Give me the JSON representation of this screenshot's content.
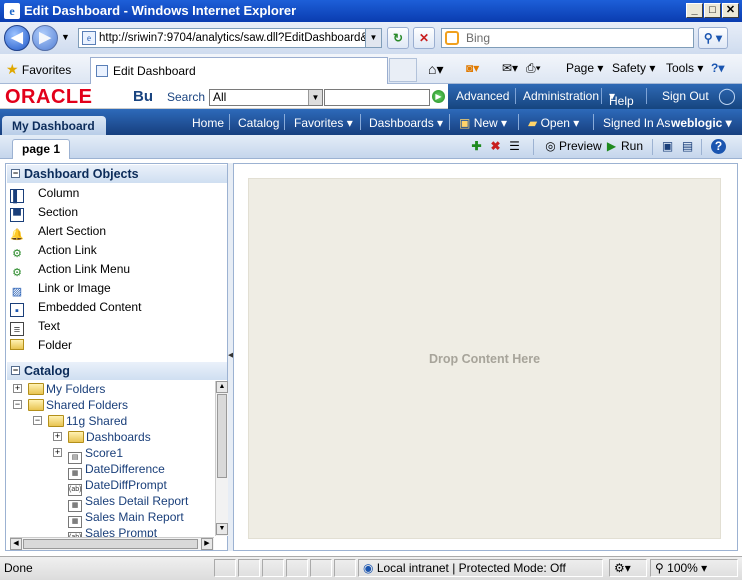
{
  "window": {
    "title": "Edit Dashboard - Windows Internet Explorer"
  },
  "address": {
    "url": "http://sriwin7:9704/analytics/saw.dll?EditDashboard&P",
    "search_placeholder": "Bing"
  },
  "favorites_bar": {
    "favorites_label": "Favorites",
    "tab_title": "Edit Dashboard"
  },
  "commands": {
    "page": "Page",
    "safety": "Safety",
    "tools": "Tools"
  },
  "oracle": {
    "logo": "ORACLE",
    "bu": "Bu",
    "search_label": "Search",
    "search_scope": "All"
  },
  "global_nav": {
    "advanced": "Advanced",
    "administration": "Administration",
    "help": "Help",
    "signout": "Sign Out"
  },
  "dash_nav": {
    "title": "My Dashboard",
    "home": "Home",
    "catalog": "Catalog",
    "favorites": "Favorites",
    "dashboards": "Dashboards",
    "new": "New",
    "open": "Open",
    "signed_in_as": "Signed In As",
    "user": "weblogic"
  },
  "page_bar": {
    "tab": "page 1",
    "preview": "Preview",
    "run": "Run"
  },
  "dashboard_objects": {
    "title": "Dashboard Objects",
    "items": [
      "Column",
      "Section",
      "Alert Section",
      "Action Link",
      "Action Link Menu",
      "Link or Image",
      "Embedded Content",
      "Text",
      "Folder"
    ]
  },
  "catalog": {
    "title": "Catalog",
    "items": [
      "My Folders",
      "Shared Folders",
      "11g Shared",
      "Dashboards",
      "Score1",
      "DateDifference",
      "DateDiffPrompt",
      "Sales Detail Report",
      "Sales Main Report",
      "Sales Prompt"
    ]
  },
  "canvas": {
    "drop_text": "Drop Content Here"
  },
  "status": {
    "done": "Done",
    "zone": "Local intranet | Protected Mode: Off",
    "zoom": "100%"
  }
}
